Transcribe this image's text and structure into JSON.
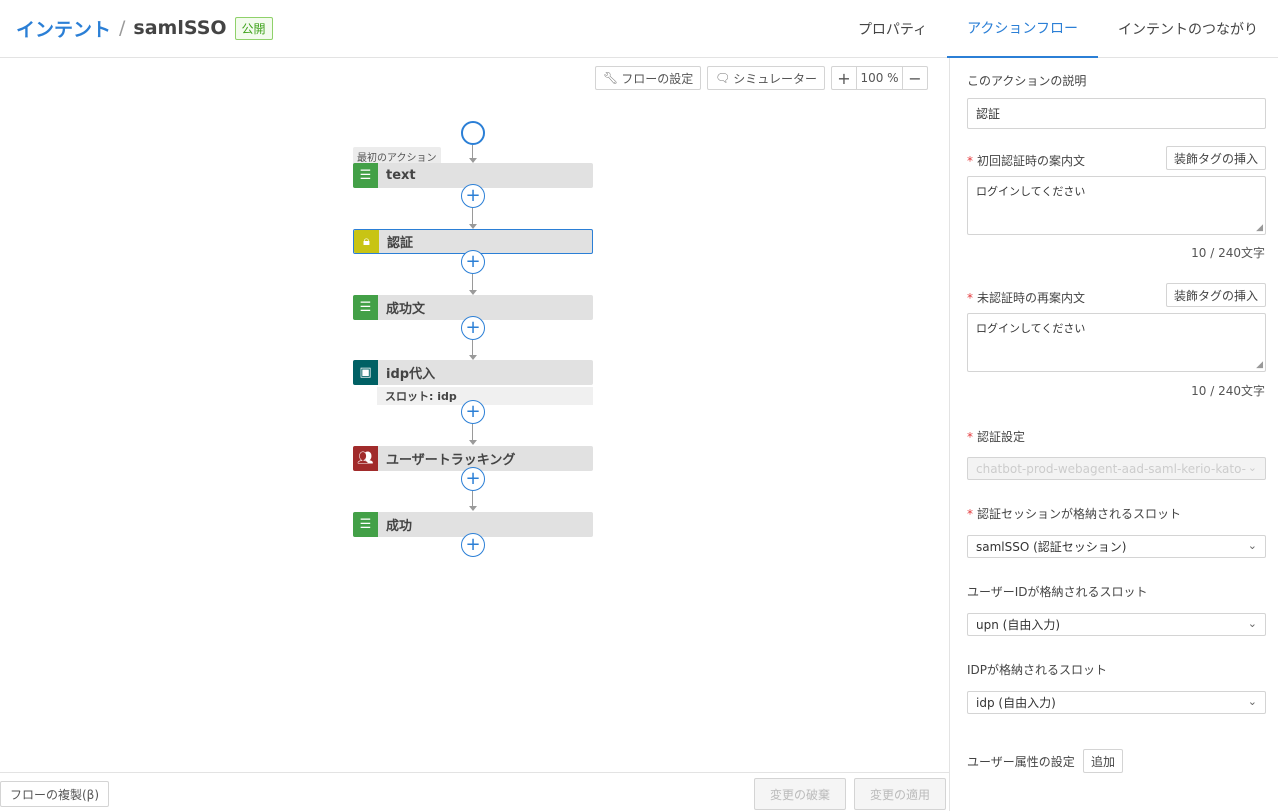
{
  "header": {
    "breadcrumb_root": "インテント",
    "separator": "/",
    "intent_name": "samlSSO",
    "status_badge": "公開",
    "tabs": [
      {
        "label": "プロパティ"
      },
      {
        "label": "アクションフロー"
      },
      {
        "label": "インテントのつながり"
      }
    ],
    "active_tab": "アクションフロー"
  },
  "toolbar": {
    "flow_settings": "フローの設定",
    "simulator": "シミュレーター",
    "zoom_in": "+",
    "zoom_value": "100 %",
    "zoom_out": "−"
  },
  "flow": {
    "first_action_label": "最初のアクション",
    "plus_symbol": "+",
    "nodes": [
      {
        "label": "text",
        "icon": "text-icon",
        "color": "#43a047"
      },
      {
        "label": "認証",
        "icon": "lock-icon",
        "color": "#c8c414"
      },
      {
        "label": "成功文",
        "icon": "text-icon",
        "color": "#43a047"
      },
      {
        "label": "idp代入",
        "icon": "slot-icon",
        "color": "#006064",
        "sub": "スロット: idp"
      },
      {
        "label": "ユーザートラッキング",
        "icon": "users-icon",
        "color": "#a12b2b"
      },
      {
        "label": "成功",
        "icon": "text-icon",
        "color": "#43a047"
      }
    ]
  },
  "footer": {
    "duplicate_flow": "フローの複製(β)",
    "discard_changes": "変更の破棄",
    "apply_changes": "変更の適用"
  },
  "panel": {
    "description_label": "このアクションの説明",
    "description_value": "認証",
    "first_auth_label": "初回認証時の案内文",
    "first_auth_value": "ログインしてください",
    "first_auth_count": "10 / 240文字",
    "insert_tag": "装飾タグの挿入",
    "unauth_label": "未認証時の再案内文",
    "unauth_value": "ログインしてください",
    "unauth_count": "10 / 240文字",
    "auth_settings_label": "認証設定",
    "auth_settings_value": "chatbot-prod-webagent-aad-saml-kerio-kato-st",
    "session_slot_label": "認証セッションが格納されるスロット",
    "session_slot_value": "samlSSO (認証セッション)",
    "userid_slot_label": "ユーザーIDが格納されるスロット",
    "userid_slot_value": "upn (自由入力)",
    "idp_slot_label": "IDPが格納されるスロット",
    "idp_slot_value": "idp (自由入力)",
    "user_attr_label": "ユーザー属性の設定",
    "add_button": "追加",
    "required_mark": "*"
  }
}
